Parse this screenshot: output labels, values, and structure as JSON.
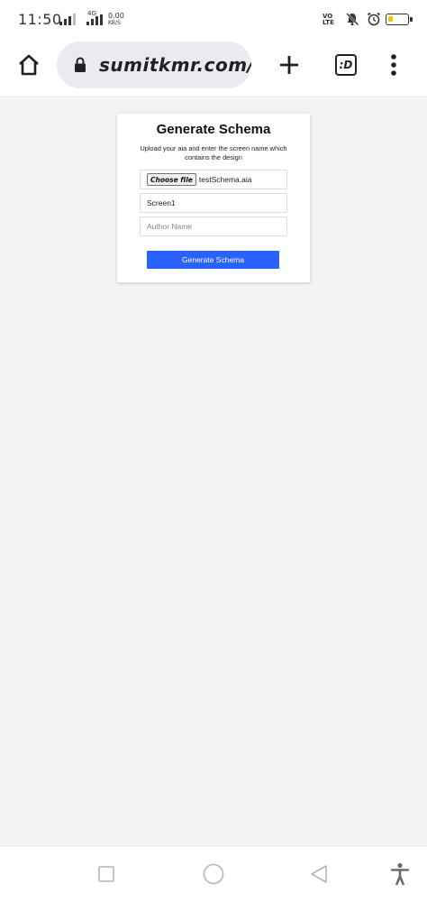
{
  "status_bar": {
    "time": "11:50",
    "network_label": "4G",
    "speed_value": "0.00",
    "speed_unit": "KB/S",
    "volte_line1": "VO",
    "volte_line2": "LTE"
  },
  "browser": {
    "url": "sumitkmr.com/dy",
    "tabs_badge": ":D"
  },
  "card": {
    "title": "Generate Schema",
    "description": "Upload your aia and enter the screen name which contains the design",
    "choose_file_label": "Choose file",
    "file_name": "testSchema.aia",
    "screen_value": "Screen1",
    "author_placeholder": "Author Name",
    "author_value": "",
    "button_label": "Generate Schema"
  },
  "colors": {
    "accent": "#2962ff",
    "content_bg": "#f3f3f3",
    "battery_level": "#f6c300"
  },
  "battery": {
    "level": 0.2
  }
}
